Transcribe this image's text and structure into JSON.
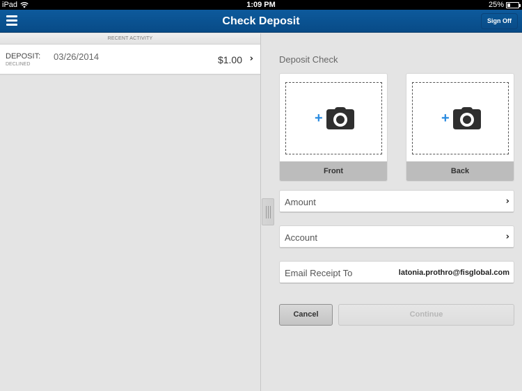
{
  "status_bar": {
    "device": "iPad",
    "time": "1:09 PM",
    "battery_percent_label": "25%",
    "battery_level": 0.25
  },
  "nav": {
    "title": "Check Deposit",
    "menu_icon": "hamburger-menu-icon",
    "sign_off_label": "Sign Off"
  },
  "recent_activity": {
    "header": "RECENT ACTIVITY",
    "items": [
      {
        "type": "DEPOSIT:",
        "status": "DECLINED",
        "date": "03/26/2014",
        "amount": "$1.00"
      }
    ]
  },
  "deposit": {
    "title": "Deposit Check",
    "front_label": "Front",
    "back_label": "Back",
    "capture_icon": "add-camera-icon",
    "amount_label": "Amount",
    "account_label": "Account",
    "email_label": "Email Receipt To",
    "email_value": "latonia.prothro@fisglobal.com",
    "cancel_label": "Cancel",
    "continue_label": "Continue"
  },
  "colors": {
    "nav_bar": "#0b5494",
    "accent_plus": "#2a8be0",
    "card_label_bg": "#bcbcbc"
  }
}
